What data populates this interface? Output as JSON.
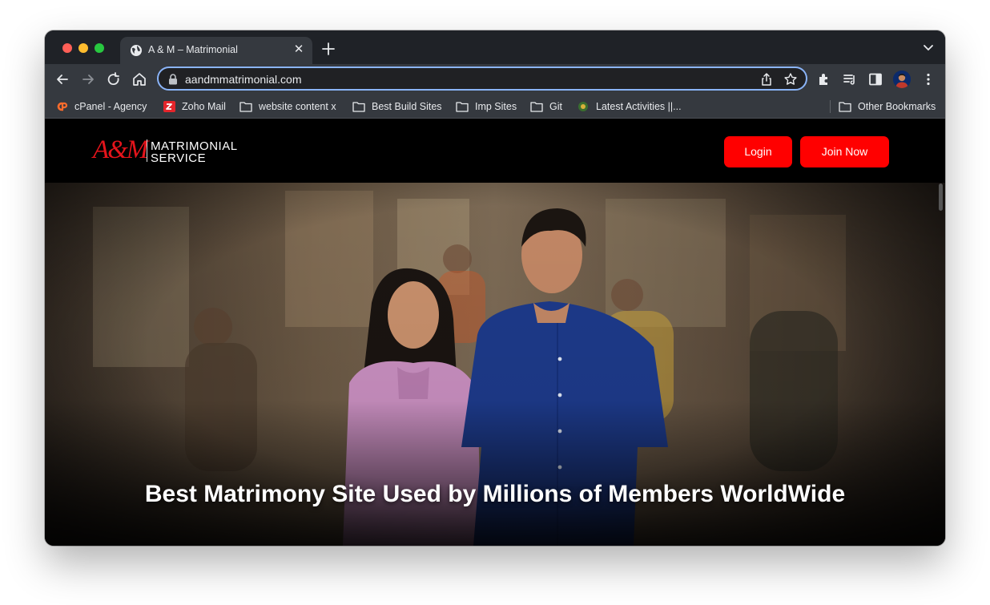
{
  "browser": {
    "tab_title": "A & M – Matrimonial",
    "tab_favicon": "globe-icon",
    "url": "aandmmatrimonial.com",
    "accent": "#8ab4f8",
    "bookmarks": [
      {
        "label": "cPanel - Agency",
        "icon": "cpanel-icon"
      },
      {
        "label": "Zoho Mail",
        "icon": "zoho-icon"
      },
      {
        "label": "website content x",
        "icon": "folder-icon"
      },
      {
        "label": "Best Build Sites",
        "icon": "folder-icon"
      },
      {
        "label": "Imp Sites",
        "icon": "folder-icon"
      },
      {
        "label": "Git",
        "icon": "folder-icon"
      },
      {
        "label": "Latest Activities ||...",
        "icon": "site-icon"
      },
      {
        "label": "Other Bookmarks",
        "icon": "folder-icon"
      }
    ]
  },
  "site": {
    "logo": {
      "mark": "A&M",
      "line1": "MATRIMONIAL",
      "line2": "SERVICE"
    },
    "login_label": "Login",
    "join_label": "Join Now",
    "button_color": "#ff0000",
    "hero_title": "Best Matrimony Site Used by Millions of Members WorldWide"
  }
}
